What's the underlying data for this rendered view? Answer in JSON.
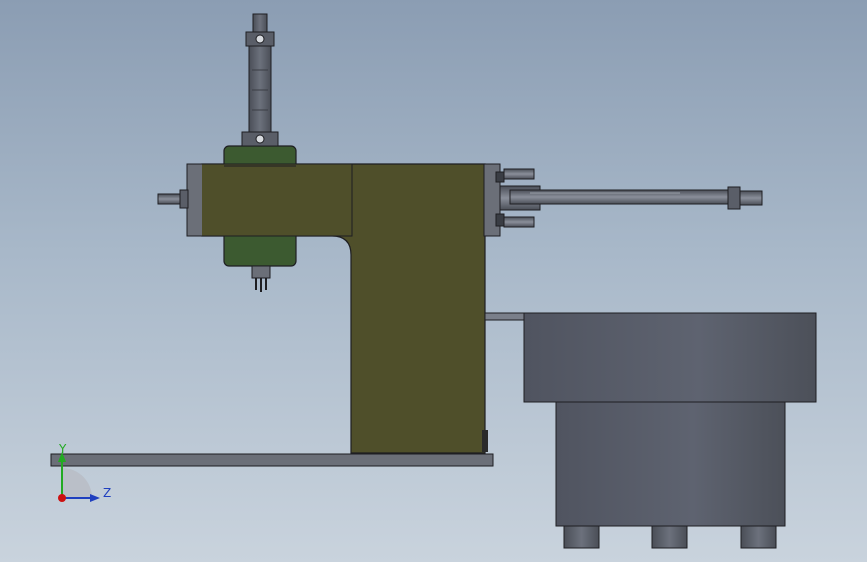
{
  "view": {
    "background_top": "#8b9db3",
    "background_bottom": "#c9d3dd"
  },
  "colors": {
    "frame": "#4f4f2a",
    "spindle_housing": "#3c5a30",
    "steel": "#5a5e68",
    "steel_light": "#7a7f8a",
    "base_plate": "#6b6f78",
    "outline": "#1e1e22"
  },
  "triad": {
    "y_label": "Y",
    "z_label": "Z",
    "y_color": "#22aa22",
    "z_color": "#1f3fbf",
    "origin_color": "#cc1111"
  }
}
